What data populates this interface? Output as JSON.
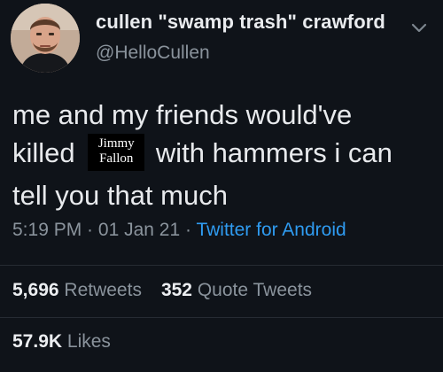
{
  "user": {
    "display_name": "cullen \"swamp trash\" crawford",
    "handle": "@HelloCullen"
  },
  "tweet": {
    "line1": "me and my friends would've",
    "line2_before": "killed",
    "line2_after": "with hammers i can",
    "line3": "tell you that much",
    "censor_label_1": "Jimmy",
    "censor_label_2": "Fallon"
  },
  "meta": {
    "time": "5:19 PM",
    "dot1": " · ",
    "date": "01 Jan 21",
    "dot2": " · ",
    "source": "Twitter for Android"
  },
  "stats": {
    "retweets_count": "5,696",
    "retweets_label": "Retweets",
    "quotes_count": "352",
    "quotes_label": "Quote Tweets",
    "likes_count": "57.9K",
    "likes_label": "Likes"
  },
  "icons": {
    "menu": "chevron-down-icon"
  },
  "colors": {
    "background": "#0f1319",
    "text": "#e8eaed",
    "secondary": "#8a939c",
    "link": "#2f9bf0"
  }
}
